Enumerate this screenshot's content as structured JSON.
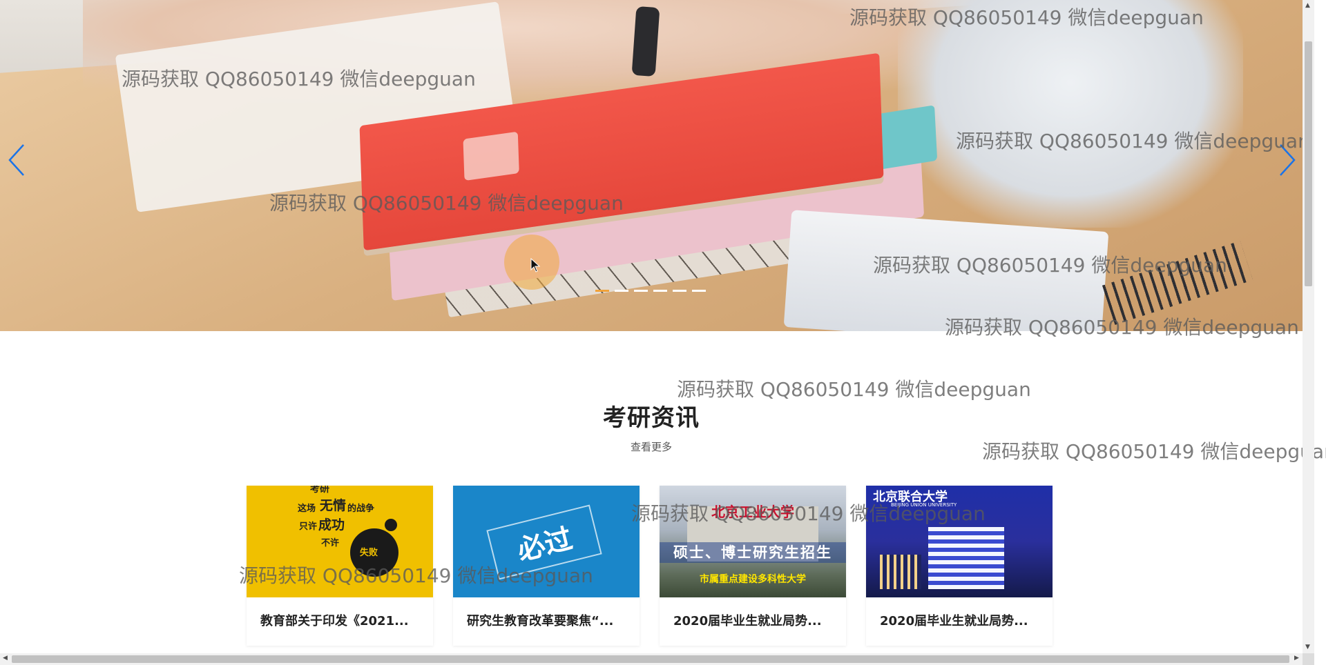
{
  "watermark_text": "源码获取 QQ86050149 微信deepguan",
  "carousel": {
    "indicator_count": 6,
    "active_index": 0,
    "accent_color": "#f0a23a",
    "arrow_color": "#1a73e8"
  },
  "news": {
    "title": "考研资讯",
    "view_more": "查看更多",
    "cards": [
      {
        "caption": "教育部关于印发《2021...",
        "thumb_lines": [
          "考研",
          "这场",
          "无情",
          "的战争",
          "只许",
          "成功",
          "不许",
          "失败"
        ]
      },
      {
        "caption": "研究生教育改革要聚焦“...",
        "thumb_lines": [
          "必过"
        ]
      },
      {
        "caption": "2020届毕业生就业局势...",
        "thumb_lines": [
          "北京工业大学",
          "硕士、博士研究生招生",
          "市属重点建设多科性大学"
        ]
      },
      {
        "caption": "2020届毕业生就业局势...",
        "thumb_lines": [
          "北京联合大学",
          "BEIJING UNION UNIVERSITY"
        ]
      }
    ]
  }
}
